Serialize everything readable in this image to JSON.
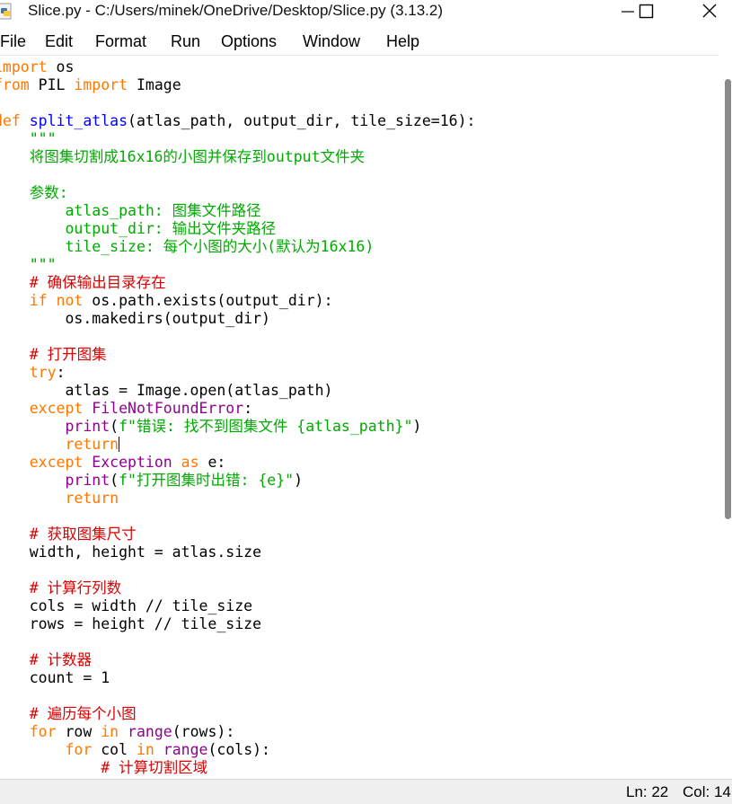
{
  "window": {
    "title": "Slice.py - C:/Users/minek/OneDrive/Desktop/Slice.py (3.13.2)",
    "icon": "python-file-icon"
  },
  "menu": [
    {
      "label": "File"
    },
    {
      "label": "Edit"
    },
    {
      "label": "Format"
    },
    {
      "label": "Run"
    },
    {
      "label": "Options"
    },
    {
      "label": "Window"
    },
    {
      "label": "Help"
    }
  ],
  "syntax_colors": {
    "keyword": "#ff7700",
    "builtin": "#900090",
    "definition": "#0000ff",
    "string": "#00aa00",
    "comment": "#dd0000"
  },
  "code_lines": [
    [
      {
        "t": "import",
        "c": "kw"
      },
      {
        "t": " os"
      }
    ],
    [
      {
        "t": "from",
        "c": "kw"
      },
      {
        "t": " PIL "
      },
      {
        "t": "import",
        "c": "kw"
      },
      {
        "t": " Image"
      }
    ],
    [],
    [
      {
        "t": "def",
        "c": "kw"
      },
      {
        "t": " "
      },
      {
        "t": "split_atlas",
        "c": "fn"
      },
      {
        "t": "(atlas_path, output_dir, tile_size=16):"
      }
    ],
    [
      {
        "t": "    \"\"\"",
        "c": "str"
      }
    ],
    [
      {
        "t": "    将图集切割成16x16的小图并保存到output文件夹",
        "c": "str"
      }
    ],
    [],
    [
      {
        "t": "    参数:",
        "c": "str"
      }
    ],
    [
      {
        "t": "        atlas_path: 图集文件路径",
        "c": "str"
      }
    ],
    [
      {
        "t": "        output_dir: 输出文件夹路径",
        "c": "str"
      }
    ],
    [
      {
        "t": "        tile_size: 每个小图的大小(默认为16x16)",
        "c": "str"
      }
    ],
    [
      {
        "t": "    \"\"\"",
        "c": "str"
      }
    ],
    [
      {
        "t": "    # 确保输出目录存在",
        "c": "cm"
      }
    ],
    [
      {
        "t": "    "
      },
      {
        "t": "if",
        "c": "kw"
      },
      {
        "t": " "
      },
      {
        "t": "not",
        "c": "kw"
      },
      {
        "t": " os.path.exists(output_dir):"
      }
    ],
    [
      {
        "t": "        os.makedirs(output_dir)"
      }
    ],
    [],
    [
      {
        "t": "    # 打开图集",
        "c": "cm"
      }
    ],
    [
      {
        "t": "    "
      },
      {
        "t": "try",
        "c": "kw"
      },
      {
        "t": ":"
      }
    ],
    [
      {
        "t": "        atlas = Image.open(atlas_path)"
      }
    ],
    [
      {
        "t": "    "
      },
      {
        "t": "except",
        "c": "kw"
      },
      {
        "t": " "
      },
      {
        "t": "FileNotFoundError",
        "c": "bi"
      },
      {
        "t": ":"
      }
    ],
    [
      {
        "t": "        "
      },
      {
        "t": "print",
        "c": "bi"
      },
      {
        "t": "("
      },
      {
        "t": "f\"错误: 找不到图集文件 {atlas_path}\"",
        "c": "str"
      },
      {
        "t": ")"
      }
    ],
    [
      {
        "t": "        "
      },
      {
        "t": "return",
        "c": "kw"
      },
      {
        "t": "",
        "caret": true
      }
    ],
    [
      {
        "t": "    "
      },
      {
        "t": "except",
        "c": "kw"
      },
      {
        "t": " "
      },
      {
        "t": "Exception",
        "c": "bi"
      },
      {
        "t": " "
      },
      {
        "t": "as",
        "c": "kw"
      },
      {
        "t": " e:"
      }
    ],
    [
      {
        "t": "        "
      },
      {
        "t": "print",
        "c": "bi"
      },
      {
        "t": "("
      },
      {
        "t": "f\"打开图集时出错: {e}\"",
        "c": "str"
      },
      {
        "t": ")"
      }
    ],
    [
      {
        "t": "        "
      },
      {
        "t": "return",
        "c": "kw"
      }
    ],
    [],
    [
      {
        "t": "    # 获取图集尺寸",
        "c": "cm"
      }
    ],
    [
      {
        "t": "    width, height = atlas.size"
      }
    ],
    [],
    [
      {
        "t": "    # 计算行列数",
        "c": "cm"
      }
    ],
    [
      {
        "t": "    cols = width // tile_size"
      }
    ],
    [
      {
        "t": "    rows = height // tile_size"
      }
    ],
    [],
    [
      {
        "t": "    # 计数器",
        "c": "cm"
      }
    ],
    [
      {
        "t": "    count = 1"
      }
    ],
    [],
    [
      {
        "t": "    # 遍历每个小图",
        "c": "cm"
      }
    ],
    [
      {
        "t": "    "
      },
      {
        "t": "for",
        "c": "kw"
      },
      {
        "t": " row "
      },
      {
        "t": "in",
        "c": "kw"
      },
      {
        "t": " "
      },
      {
        "t": "range",
        "c": "bi"
      },
      {
        "t": "(rows):"
      }
    ],
    [
      {
        "t": "        "
      },
      {
        "t": "for",
        "c": "kw"
      },
      {
        "t": " col "
      },
      {
        "t": "in",
        "c": "kw"
      },
      {
        "t": " "
      },
      {
        "t": "range",
        "c": "bi"
      },
      {
        "t": "(cols):"
      }
    ],
    [
      {
        "t": "            # 计算切割区域",
        "c": "cm"
      }
    ]
  ],
  "status": {
    "line": "Ln: 22",
    "col": "Col: 14"
  }
}
